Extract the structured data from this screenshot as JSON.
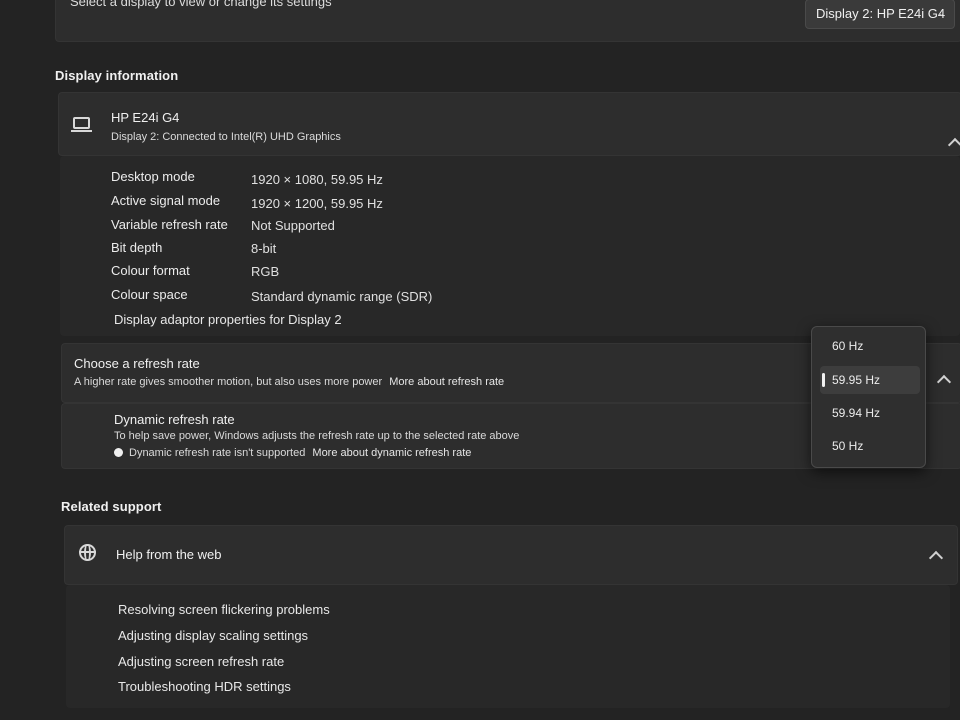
{
  "header": {
    "select_display_text": "Select a display to view or change its settings",
    "display_dropdown_value": "Display 2: HP E24i G4"
  },
  "display_information": {
    "section_title": "Display information",
    "monitor_name": "HP E24i G4",
    "monitor_connection": "Display 2: Connected to Intel(R) UHD Graphics",
    "rows": [
      {
        "label": "Desktop mode",
        "value": "1920 × 1080, 59.95 Hz"
      },
      {
        "label": "Active signal mode",
        "value": "1920 × 1200, 59.95 Hz"
      },
      {
        "label": "Variable refresh rate",
        "value": "Not Supported"
      },
      {
        "label": "Bit depth",
        "value": "8-bit"
      },
      {
        "label": "Colour format",
        "value": "RGB"
      },
      {
        "label": "Colour space",
        "value": "Standard dynamic range (SDR)"
      }
    ],
    "adaptor_link": "Display adaptor properties for Display 2"
  },
  "refresh_rate": {
    "title": "Choose a refresh rate",
    "description": "A higher rate gives smoother motion, but also uses more power",
    "more_link": "More about refresh rate",
    "options": [
      "60 Hz",
      "59.95 Hz",
      "59.94 Hz",
      "50 Hz"
    ],
    "selected": "59.95 Hz"
  },
  "dynamic_refresh": {
    "title": "Dynamic refresh rate",
    "description": "To help save power, Windows adjusts the refresh rate up to the selected rate above",
    "status": "Dynamic refresh rate isn't supported",
    "more_link": "More about dynamic refresh rate"
  },
  "related_support": {
    "section_title": "Related support",
    "help_title": "Help from the web",
    "links": [
      "Resolving screen flickering problems",
      "Adjusting display scaling settings",
      "Adjusting screen refresh rate",
      "Troubleshooting HDR settings"
    ]
  },
  "icons": {
    "monitor": "monitor-icon",
    "globe": "globe-icon",
    "chevron_up": "chevron-up-icon",
    "chevron_down": "chevron-down-icon"
  }
}
